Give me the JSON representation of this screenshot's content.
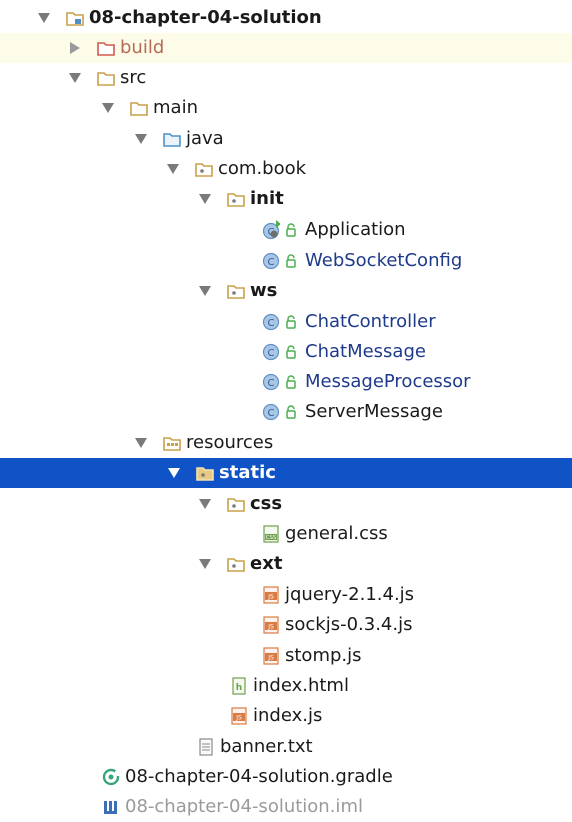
{
  "tree": {
    "root": "08-chapter-04-solution",
    "build": "build",
    "src": "src",
    "main": "main",
    "java": "java",
    "com_book": "com.book",
    "init": "init",
    "application": "Application",
    "websocket_config": "WebSocketConfig",
    "ws": "ws",
    "chat_controller": "ChatController",
    "chat_message": "ChatMessage",
    "message_processor": "MessageProcessor",
    "server_message": "ServerMessage",
    "resources": "resources",
    "static": "static",
    "css": "css",
    "general_css": "general.css",
    "ext": "ext",
    "jquery": "jquery-2.1.4.js",
    "sockjs": "sockjs-0.3.4.js",
    "stomp": "stomp.js",
    "index_html": "index.html",
    "index_js": "index.js",
    "banner": "banner.txt",
    "gradle": "08-chapter-04-solution.gradle",
    "iml": "08-chapter-04-solution.iml"
  },
  "colors": {
    "selection": "#0f53c6",
    "hover_row": "#fdfce8",
    "folder": "#c9a04a",
    "class_label": "#1e3a8a",
    "class_icon": "#5e91c9",
    "excluded_folder": "#d1584d",
    "source_folder": "#4f8fc8"
  }
}
